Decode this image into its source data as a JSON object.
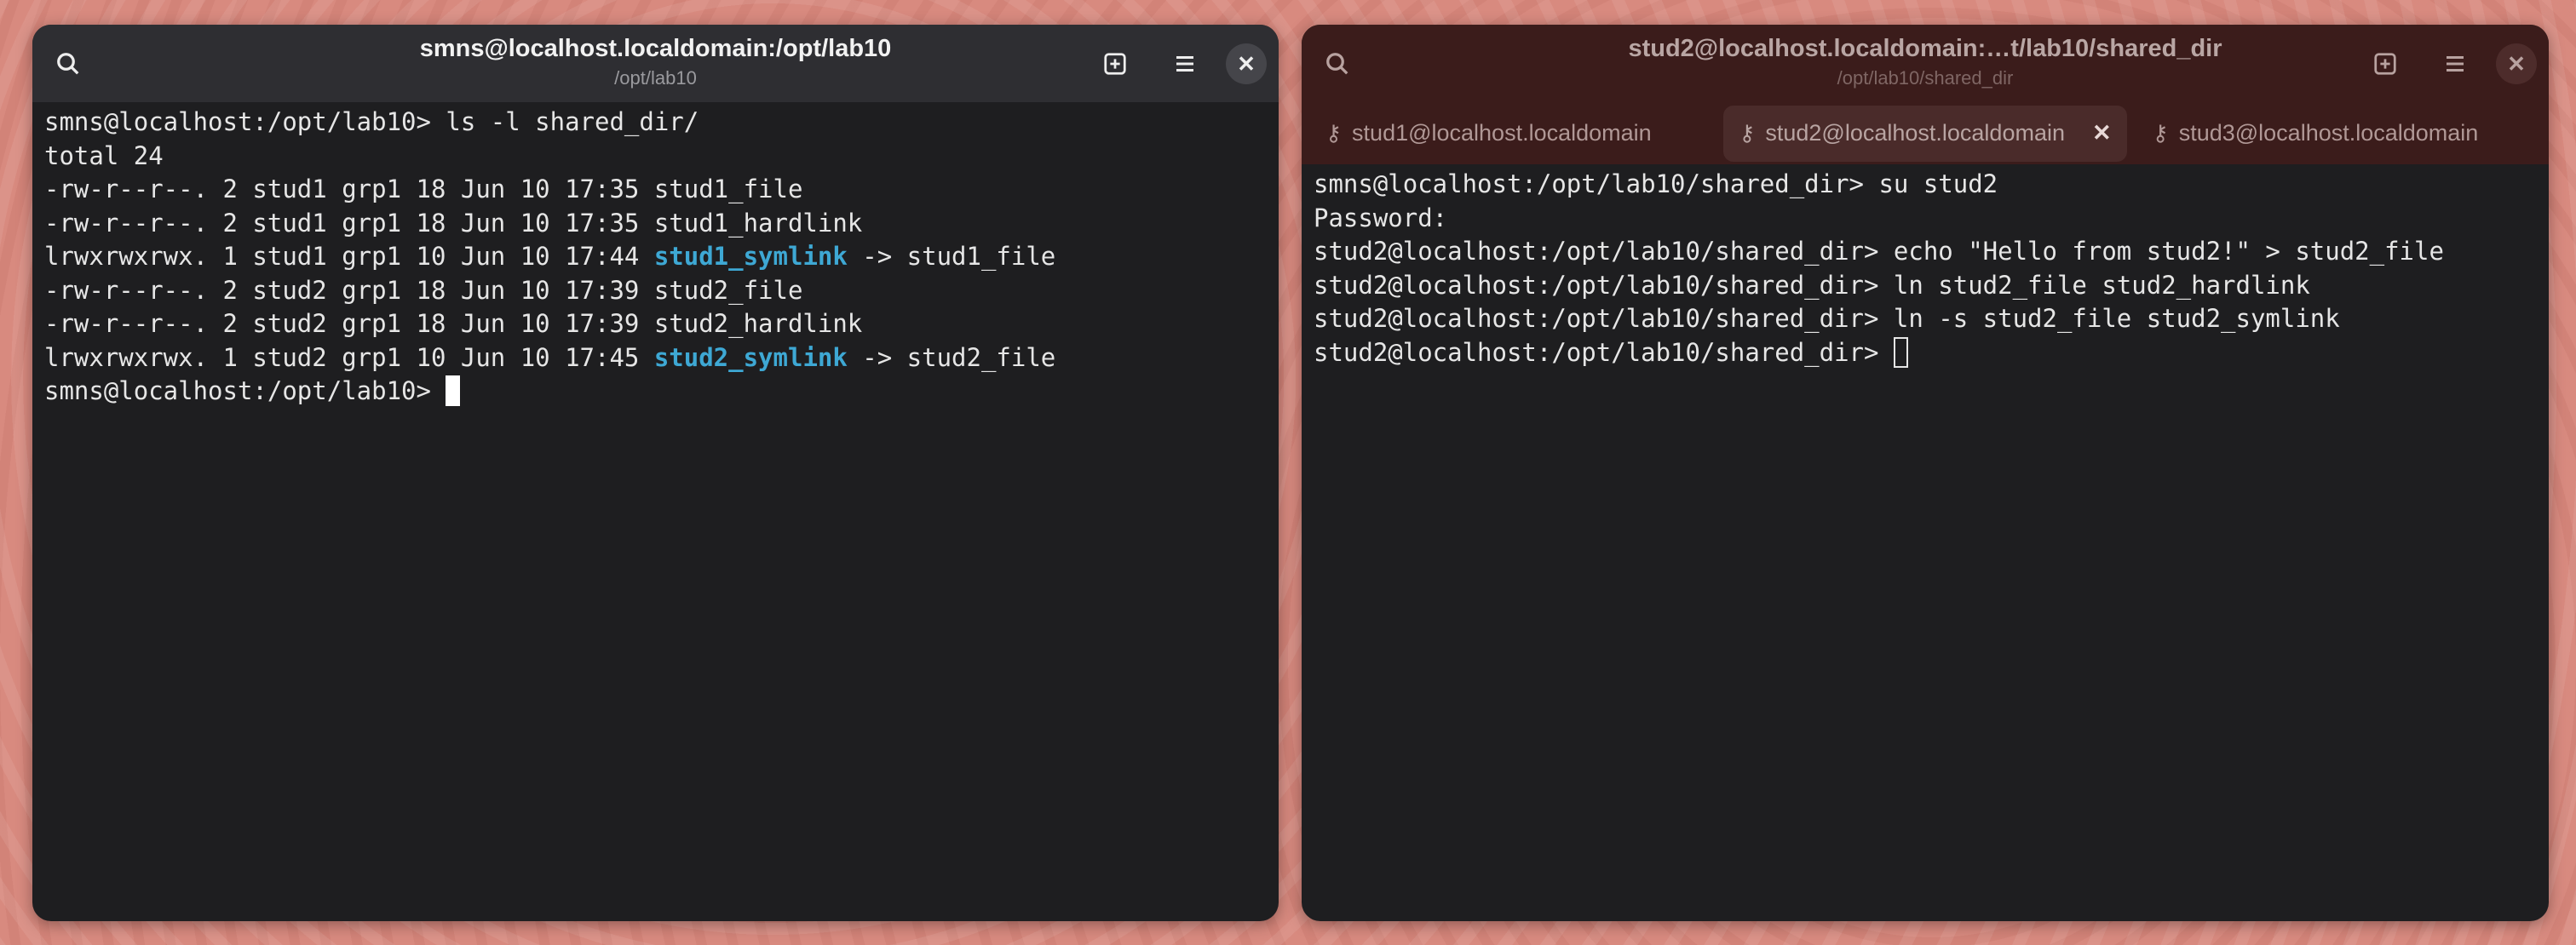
{
  "left_window": {
    "title": "smns@localhost.localdomain:/opt/lab10",
    "subtitle": "/opt/lab10",
    "icons": {
      "search": "search-icon",
      "new_tab": "new-tab-icon",
      "menu": "hamburger-menu-icon",
      "close": "close-icon"
    },
    "close_glyph": "✕",
    "lines": [
      {
        "text": "smns@localhost:/opt/lab10> ls -l shared_dir/"
      },
      {
        "text": "total 24"
      },
      {
        "text": "-rw-r--r--. 2 stud1 grp1 18 Jun 10 17:35 stud1_file"
      },
      {
        "text": "-rw-r--r--. 2 stud1 grp1 18 Jun 10 17:35 stud1_hardlink"
      },
      {
        "text": "lrwxrwxrwx. 1 stud1 grp1 10 Jun 10 17:44 ",
        "link": "stud1_symlink",
        "after": " -> stud1_file"
      },
      {
        "text": "-rw-r--r--. 2 stud2 grp1 18 Jun 10 17:39 stud2_file"
      },
      {
        "text": "-rw-r--r--. 2 stud2 grp1 18 Jun 10 17:39 stud2_hardlink"
      },
      {
        "text": "lrwxrwxrwx. 1 stud2 grp1 10 Jun 10 17:45 ",
        "link": "stud2_symlink",
        "after": " -> stud2_file"
      }
    ],
    "prompt": "smns@localhost:/opt/lab10> "
  },
  "right_window": {
    "title": "stud2@localhost.localdomain:…t/lab10/shared_dir",
    "subtitle": "/opt/lab10/shared_dir",
    "close_glyph": "✕",
    "tabs": [
      {
        "label": "stud1@localhost.localdomain",
        "active": false,
        "icon": "key-icon"
      },
      {
        "label": "stud2@localhost.localdomain",
        "active": true,
        "icon": "key-icon"
      },
      {
        "label": "stud3@localhost.localdomain",
        "active": false,
        "icon": "key-icon"
      }
    ],
    "lines": [
      "smns@localhost:/opt/lab10/shared_dir> su stud2",
      "Password:",
      "stud2@localhost:/opt/lab10/shared_dir> echo \"Hello from stud2!\" > stud2_file",
      "stud2@localhost:/opt/lab10/shared_dir> ln stud2_file stud2_hardlink",
      "stud2@localhost:/opt/lab10/shared_dir> ln -s stud2_file stud2_symlink"
    ],
    "prompt": "stud2@localhost:/opt/lab10/shared_dir> "
  },
  "colors": {
    "symlink": "#3ea8d4",
    "right_header": "#3b1c1b",
    "terminal_bg": "#1e1e20"
  }
}
